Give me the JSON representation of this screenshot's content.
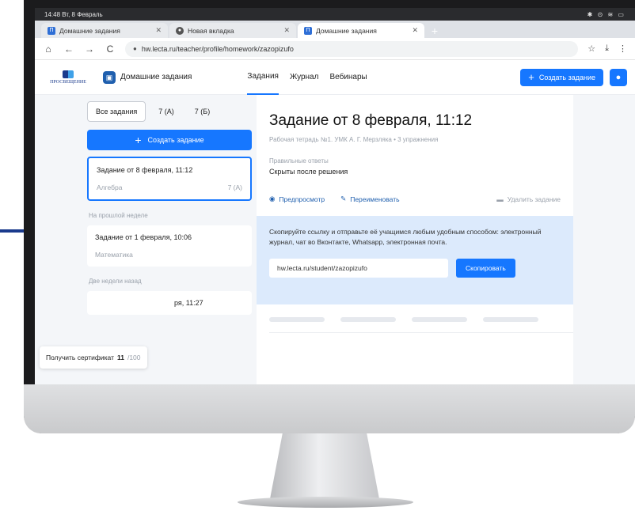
{
  "statusbar": {
    "time": "14:48 Вт, 8 Февраль",
    "icons": "✱ ⊙ ≋ ▭"
  },
  "browser": {
    "tabs": [
      {
        "title": "Домашние задания",
        "icon": "lecta-favicon",
        "active": false
      },
      {
        "title": "Новая вкладка",
        "icon": "globe-favicon",
        "active": false
      },
      {
        "title": "Домашние задания",
        "icon": "lecta-favicon",
        "active": true
      }
    ],
    "new_tab": "+",
    "url": "hw.lecta.ru/teacher/profile/homework/zazopizufo",
    "icons": {
      "home": "⌂",
      "back": "←",
      "forward": "→",
      "reload": "C",
      "bookmark": "☆",
      "download": "⤓",
      "menu": "⋮"
    }
  },
  "app": {
    "logo_text": "ПРОСВЕЩЕНИЕ",
    "name": "Домашние задания",
    "nav": [
      "Задания",
      "Журнал",
      "Вебинары"
    ],
    "create_label": "Создать задание",
    "accent": "#1677ff"
  },
  "sidebar": {
    "filters": [
      "Все задания",
      "7 (А)",
      "7 (Б)"
    ],
    "create_label": "Создать задание",
    "selected_card": {
      "title": "Задание от 8 февраля, 11:12",
      "subject": "Алгебра",
      "group": "7 (А)"
    },
    "group_last_week": "На прошлой неделе",
    "card2": {
      "title": "Задание от 1 февраля, 10:06",
      "subject": "Математика"
    },
    "group_two_weeks": "Две недели назад",
    "partial_card": {
      "title_tail": "ря, 11:27"
    }
  },
  "certificate": {
    "label": "Получить сертификат",
    "current": "11",
    "total": "/100"
  },
  "task": {
    "title": "Задание от 8 февраля, 11:12",
    "subtitle": "Рабочая тетрадь №1. УМК А. Г. Мерзляка • 3 упражнения",
    "answers_label": "Правильные ответы",
    "answers_value": "Скрыты после решения",
    "preview": "Предпросмотр",
    "rename": "Переименовать",
    "delete": "Удалить задание",
    "share_text": "Скопируйте ссылку и отправьте её учащимся любым удобным способом: электронный журнал, чат во Вконтакте, Whatsapp, электронная почта.",
    "share_link": "hw.lecta.ru/student/zazopizufo",
    "copy_label": "Скопировать"
  }
}
